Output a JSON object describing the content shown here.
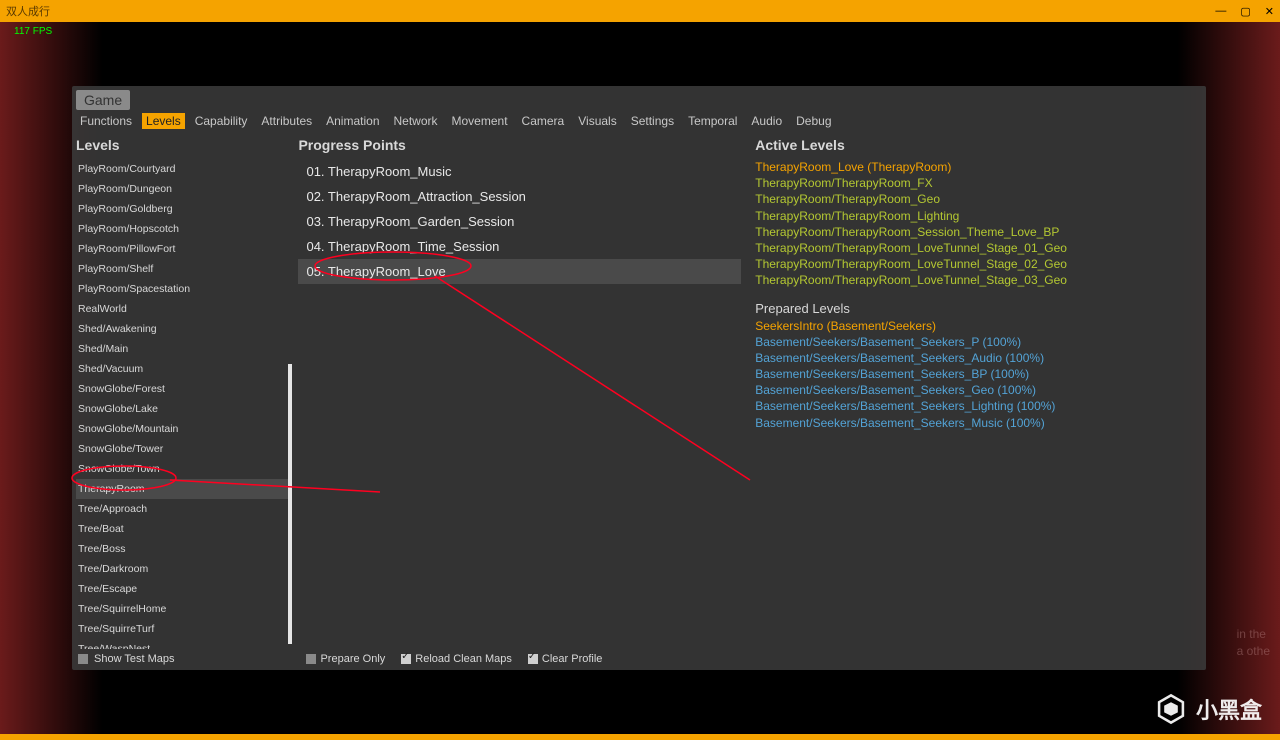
{
  "window": {
    "title": "双人成行"
  },
  "fps": "117 FPS",
  "game_chip": "Game",
  "menubar": [
    "Functions",
    "Levels",
    "Capability",
    "Attributes",
    "Animation",
    "Network",
    "Movement",
    "Camera",
    "Visuals",
    "Settings",
    "Temporal",
    "Audio",
    "Debug"
  ],
  "menubar_active": 1,
  "levels_header": "Levels",
  "levels": [
    "PlayRoom/Courtyard",
    "PlayRoom/Dungeon",
    "PlayRoom/Goldberg",
    "PlayRoom/Hopscotch",
    "PlayRoom/PillowFort",
    "PlayRoom/Shelf",
    "PlayRoom/Spacestation",
    "RealWorld",
    "Shed/Awakening",
    "Shed/Main",
    "Shed/Vacuum",
    "SnowGlobe/Forest",
    "SnowGlobe/Lake",
    "SnowGlobe/Mountain",
    "SnowGlobe/Tower",
    "SnowGlobe/Town",
    "TherapyRoom",
    "Tree/Approach",
    "Tree/Boat",
    "Tree/Boss",
    "Tree/Darkroom",
    "Tree/Escape",
    "Tree/SquirrelHome",
    "Tree/SquirreTurf",
    "Tree/WaspNest"
  ],
  "levels_selected": 16,
  "show_test_maps": "Show Test Maps",
  "progress_header": "Progress Points",
  "progress": [
    "01. TherapyRoom_Music",
    "02. TherapyRoom_Attraction_Session",
    "03. TherapyRoom_Garden_Session",
    "04. TherapyRoom_Time_Session",
    "05. TherapyRoom_Love"
  ],
  "progress_selected": 4,
  "checks": {
    "prepare_only": {
      "label": "Prepare Only",
      "on": false
    },
    "reload_clean": {
      "label": "Reload Clean Maps",
      "on": true
    },
    "clear_profile": {
      "label": "Clear Profile",
      "on": true
    }
  },
  "active_levels_header": "Active Levels",
  "active_levels": [
    {
      "text": "TherapyRoom_Love (TherapyRoom)",
      "cls": "al-orange"
    },
    {
      "text": "TherapyRoom/TherapyRoom_FX",
      "cls": "al-olive"
    },
    {
      "text": "TherapyRoom/TherapyRoom_Geo",
      "cls": "al-olive"
    },
    {
      "text": "TherapyRoom/TherapyRoom_Lighting",
      "cls": "al-olive"
    },
    {
      "text": "TherapyRoom/TherapyRoom_Session_Theme_Love_BP",
      "cls": "al-olive"
    },
    {
      "text": "TherapyRoom/TherapyRoom_LoveTunnel_Stage_01_Geo",
      "cls": "al-olive"
    },
    {
      "text": "TherapyRoom/TherapyRoom_LoveTunnel_Stage_02_Geo",
      "cls": "al-olive"
    },
    {
      "text": "TherapyRoom/TherapyRoom_LoveTunnel_Stage_03_Geo",
      "cls": "al-olive"
    }
  ],
  "prepared_levels_header": "Prepared Levels",
  "prepared_levels": [
    {
      "text": "SeekersIntro (Basement/Seekers)",
      "cls": "al-orange"
    },
    {
      "text": "Basement/Seekers/Basement_Seekers_P (100%)",
      "cls": "al-blue"
    },
    {
      "text": "Basement/Seekers/Basement_Seekers_Audio (100%)",
      "cls": "al-blue"
    },
    {
      "text": "Basement/Seekers/Basement_Seekers_BP (100%)",
      "cls": "al-blue"
    },
    {
      "text": "Basement/Seekers/Basement_Seekers_Geo (100%)",
      "cls": "al-blue"
    },
    {
      "text": "Basement/Seekers/Basement_Seekers_Lighting (100%)",
      "cls": "al-blue"
    },
    {
      "text": "Basement/Seekers/Basement_Seekers_Music (100%)",
      "cls": "al-blue"
    }
  ],
  "watermark": "小黑盒",
  "bg_right": [
    "in the",
    "a othe"
  ]
}
